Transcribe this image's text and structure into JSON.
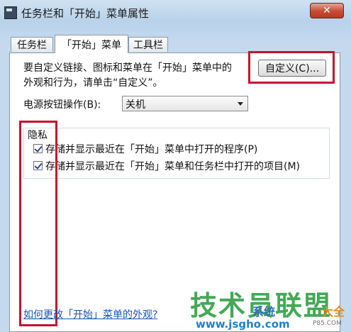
{
  "window": {
    "title": "任务栏和「开始」菜单属性",
    "close_label": "✕"
  },
  "tabs": [
    {
      "label": "任务栏",
      "active": false
    },
    {
      "label": "「开始」菜单",
      "active": true
    },
    {
      "label": "工具栏",
      "active": false
    }
  ],
  "customize": {
    "description_line1": "要自定义链接、图标和菜单在「开始」菜单中的",
    "description_line2": "外观和行为，请单击“自定义”。",
    "button_label": "自定义(C)..."
  },
  "power": {
    "label": "电源按钮操作(B):",
    "selected": "关机"
  },
  "privacy": {
    "heading": "隐私",
    "options": [
      {
        "label": "存储并显示最近在「开始」菜单中打开的程序(P)",
        "checked": true
      },
      {
        "label": "存储并显示最近在「开始」菜单和任务栏中打开的项目(M)",
        "checked": true
      }
    ]
  },
  "help_link": "如何更改「开始」菜单的外观?",
  "watermark": {
    "main": "技术员联盟",
    "sub1": "系统",
    "sub2": "大全",
    "url": "www.jsgho.com",
    "tiny": "P85.COM"
  },
  "colors": {
    "highlight_box": "#c8102e",
    "link": "#1555b6",
    "watermark_green": "#2ea043"
  },
  "icons": [
    "window-app-icon",
    "close-icon",
    "dropdown-arrow-icon",
    "checkmark-icon"
  ]
}
